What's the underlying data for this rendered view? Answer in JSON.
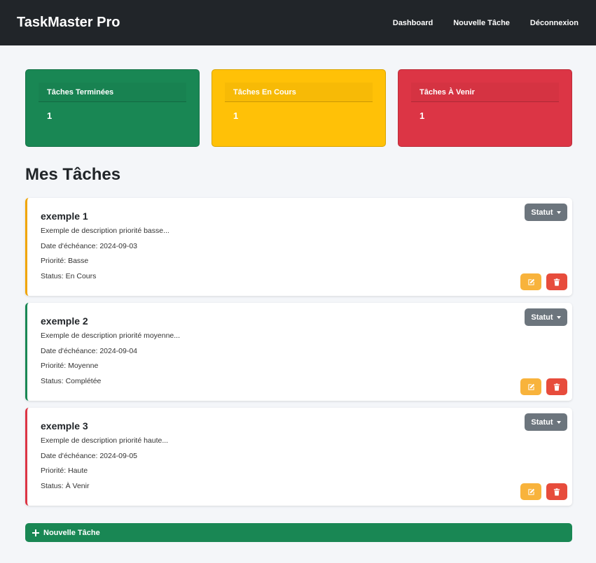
{
  "app": {
    "title": "TaskMaster Pro"
  },
  "nav": {
    "links": [
      "Dashboard",
      "Nouvelle Tâche",
      "Déconnexion"
    ]
  },
  "stats": [
    {
      "label": "Tâches Terminées",
      "value": "1",
      "color": "#198754"
    },
    {
      "label": "Tâches En Cours",
      "value": "1",
      "color": "#ffc107"
    },
    {
      "label": "Tâches À Venir",
      "value": "1",
      "color": "#dc3545"
    }
  ],
  "section": {
    "title": "Mes Tâches"
  },
  "tasks": [
    {
      "title": "exemple 1",
      "description": "Exemple de description priorité basse...",
      "due": "Date d'échéance: 2024-09-03",
      "priority": "Priorité: Basse",
      "status": "Status: En Cours",
      "statut_label": "Statut",
      "accent": "#f0a500"
    },
    {
      "title": "exemple 2",
      "description": "Exemple de description priorité moyenne...",
      "due": "Date d'échéance: 2024-09-04",
      "priority": "Priorité: Moyenne",
      "status": "Status: Complétée",
      "statut_label": "Statut",
      "accent": "#198754"
    },
    {
      "title": "exemple 3",
      "description": "Exemple de description priorité haute...",
      "due": "Date d'échéance: 2024-09-05",
      "priority": "Priorité: Haute",
      "status": "Status: À Venir",
      "statut_label": "Statut",
      "accent": "#dc3545"
    }
  ],
  "icons": {
    "edit": "edit-icon",
    "delete": "trash-icon",
    "add": "plus-icon",
    "dropdown": "caret-down-icon"
  },
  "add_button": {
    "label": "Nouvelle Tâche"
  }
}
